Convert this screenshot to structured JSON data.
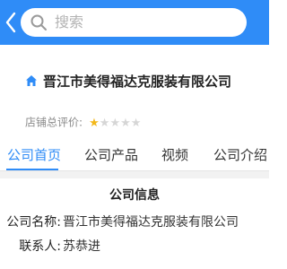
{
  "colors": {
    "accent": "#2f8cf7",
    "star_on": "#f3b81a",
    "star_off": "#d6d6d6"
  },
  "header": {
    "back_icon": "chevron-left-icon",
    "search_icon": "search-icon",
    "search_placeholder": "搜索"
  },
  "company": {
    "home_icon": "home-icon",
    "name": "晋江市美得福达克服装有限公司"
  },
  "rating": {
    "label": "店铺总评价:",
    "value": 1,
    "max": 5
  },
  "tabs": [
    {
      "label": "公司首页",
      "active": true
    },
    {
      "label": "公司产品",
      "active": false
    },
    {
      "label": "视频",
      "active": false
    },
    {
      "label": "公司介绍",
      "active": false
    }
  ],
  "info": {
    "title": "公司信息",
    "company_label": "公司名称:",
    "company_value": "晋江市美得福达克服装有限公司",
    "contact_label": "联系人:",
    "contact_value": "苏恭进"
  }
}
